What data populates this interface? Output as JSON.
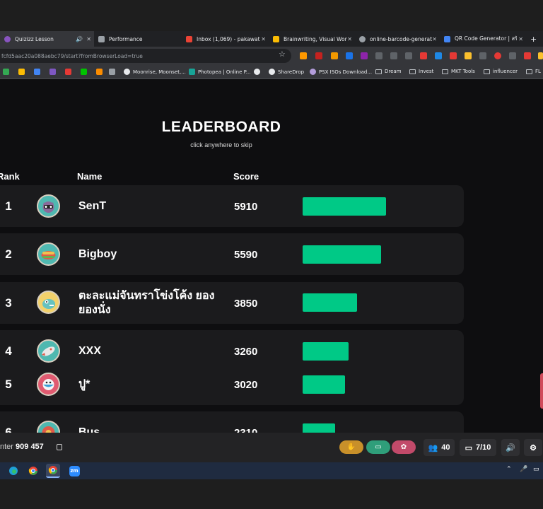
{
  "browser": {
    "tabs": [
      {
        "label": "Quizizz Lesson",
        "active": true
      },
      {
        "label": "Performance",
        "active": false
      },
      {
        "label": "Inbox (1,069) - pakawat.s",
        "active": false
      },
      {
        "label": "Brainwriting, Visual Workspace",
        "active": false
      },
      {
        "label": "online-barcode-generator",
        "active": false
      },
      {
        "label": "QR Code Generator | สร้าง",
        "active": false
      }
    ],
    "new_tab": "+",
    "url": "fcfd5aac20a088aebc79/start?fromBrowserLoad=true",
    "bookmarks": [
      "Moonrise, Moonset,...",
      "Photopea | Online P...",
      "ShareDrop",
      "PSX ISOs Download...",
      "Dream",
      "Invest",
      "MKT Tools",
      "influencer",
      "FL"
    ]
  },
  "leaderboard": {
    "title": "LEADERBOARD",
    "subtitle": "click anywhere to skip",
    "headers": {
      "rank": "Rank",
      "name": "Name",
      "score": "Score"
    },
    "max_score": 5910,
    "entries": [
      {
        "rank": "1",
        "name": "SenT",
        "score": "5910",
        "bar_fraction": 1.0
      },
      {
        "rank": "2",
        "name": "Bigboy",
        "score": "5590",
        "bar_fraction": 0.94
      },
      {
        "rank": "3",
        "name": "ตะละแม่จันทราโข่งโค้ง ยองยองนั่ง",
        "score": "3850",
        "bar_fraction": 0.65
      },
      {
        "rank": "4",
        "name": "XXX",
        "score": "3260",
        "bar_fraction": 0.55
      },
      {
        "rank": "5",
        "name": "ปู*",
        "score": "3020",
        "bar_fraction": 0.51
      },
      {
        "rank": "6",
        "name": "Bus",
        "score": "2310",
        "bar_fraction": 0.39
      }
    ]
  },
  "host_bar": {
    "join_label": "nter",
    "join_code": "909 457",
    "players": "40",
    "question_progress": "7/10"
  },
  "colors": {
    "bar": "#00c986",
    "row_bg": "#1b1b1d",
    "page_bg": "#0e0e10"
  }
}
